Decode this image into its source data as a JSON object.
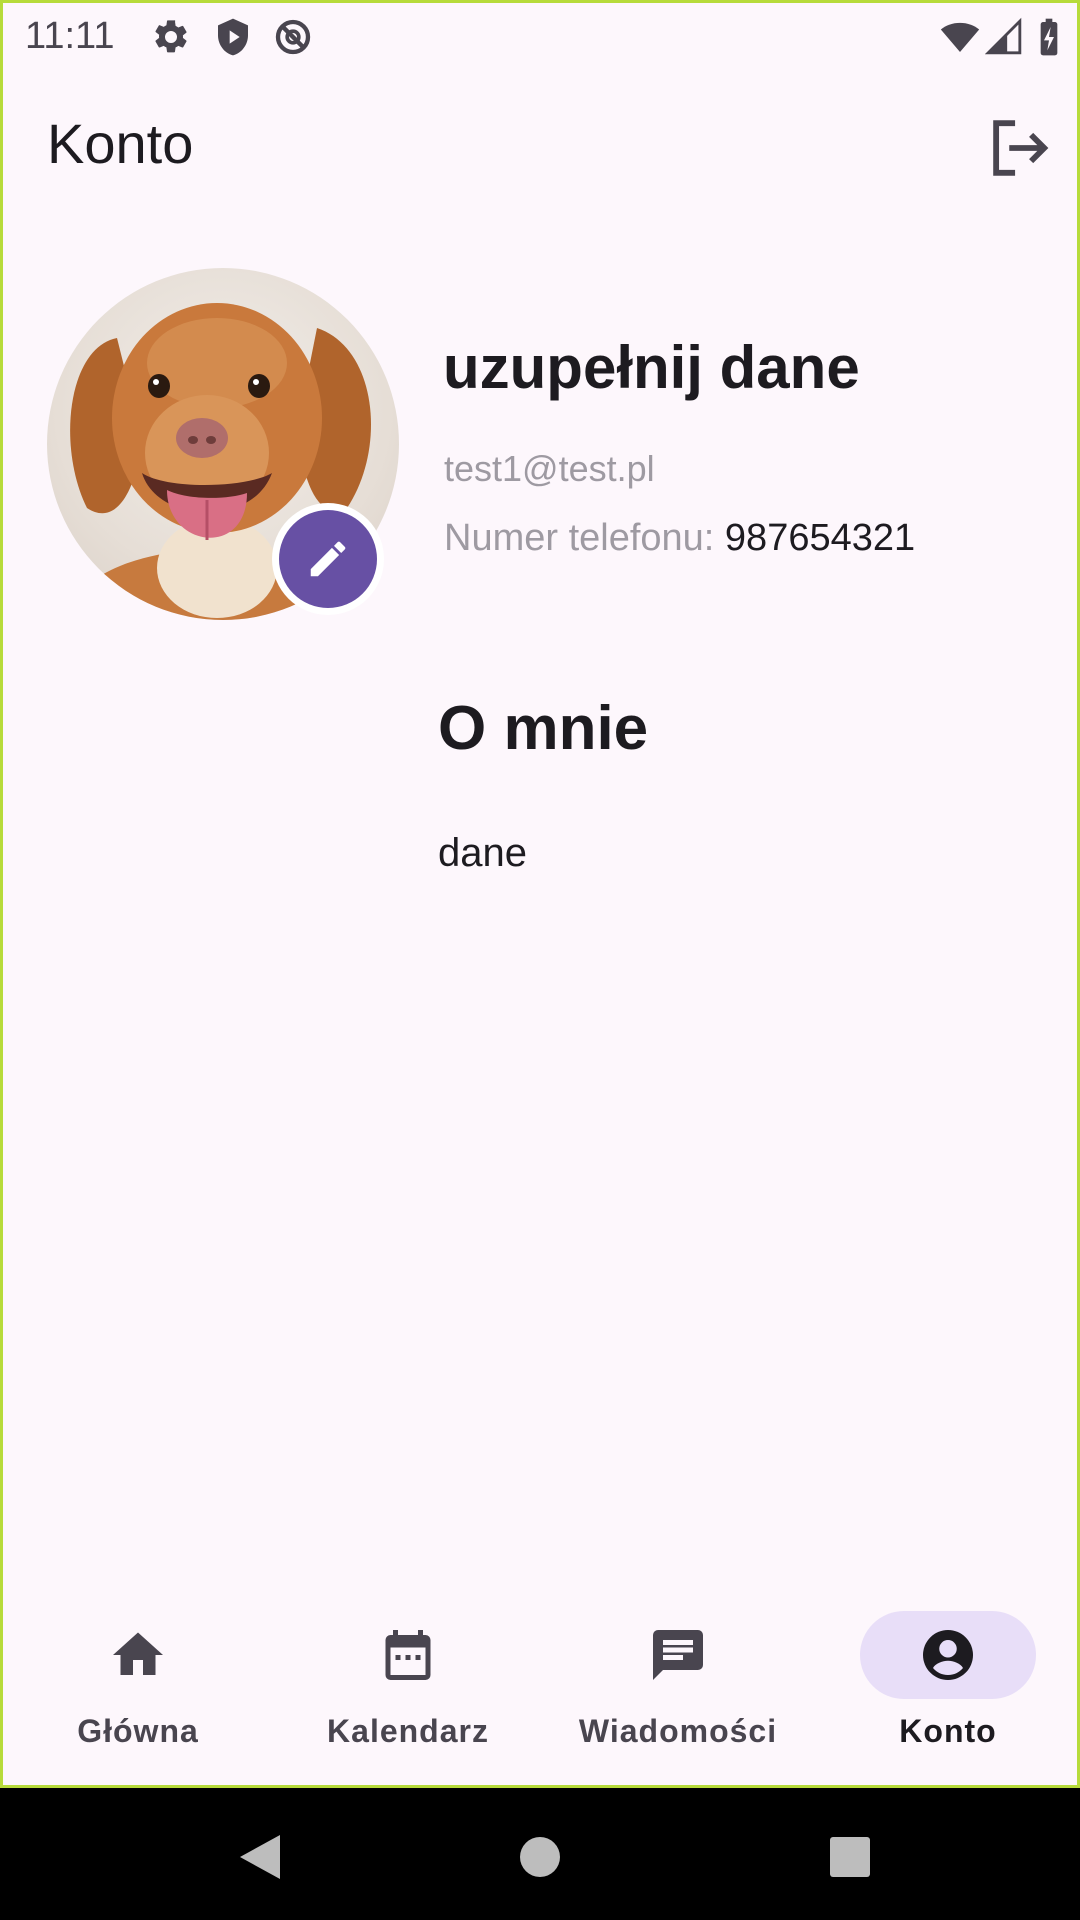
{
  "status_bar": {
    "time": "11:11",
    "icons": [
      "settings-icon",
      "shield-play-icon",
      "no-disturb-icon",
      "wifi-icon",
      "signal-icon",
      "battery-charging-icon"
    ]
  },
  "app_bar": {
    "title": "Konto",
    "action_icon": "logout-icon"
  },
  "profile": {
    "name": "uzupełnij dane",
    "email": "test1@test.pl",
    "phone_label": "Numer telefonu: ",
    "phone_value": "987654321",
    "avatar": "dog-photo",
    "edit_icon": "pencil-icon"
  },
  "about": {
    "title": "O mnie",
    "text": "dane"
  },
  "bottom_nav": {
    "items": [
      {
        "label": "Główna",
        "icon": "home-icon",
        "active": false
      },
      {
        "label": "Kalendarz",
        "icon": "calendar-icon",
        "active": false
      },
      {
        "label": "Wiadomości",
        "icon": "message-icon",
        "active": false
      },
      {
        "label": "Konto",
        "icon": "account-circle-icon",
        "active": true
      }
    ]
  },
  "colors": {
    "background": "#FDF7FC",
    "primary": "#6750A4",
    "active_indicator": "#E8DEF8",
    "text": "#1D1B20",
    "muted_text": "#9E9AA2"
  }
}
